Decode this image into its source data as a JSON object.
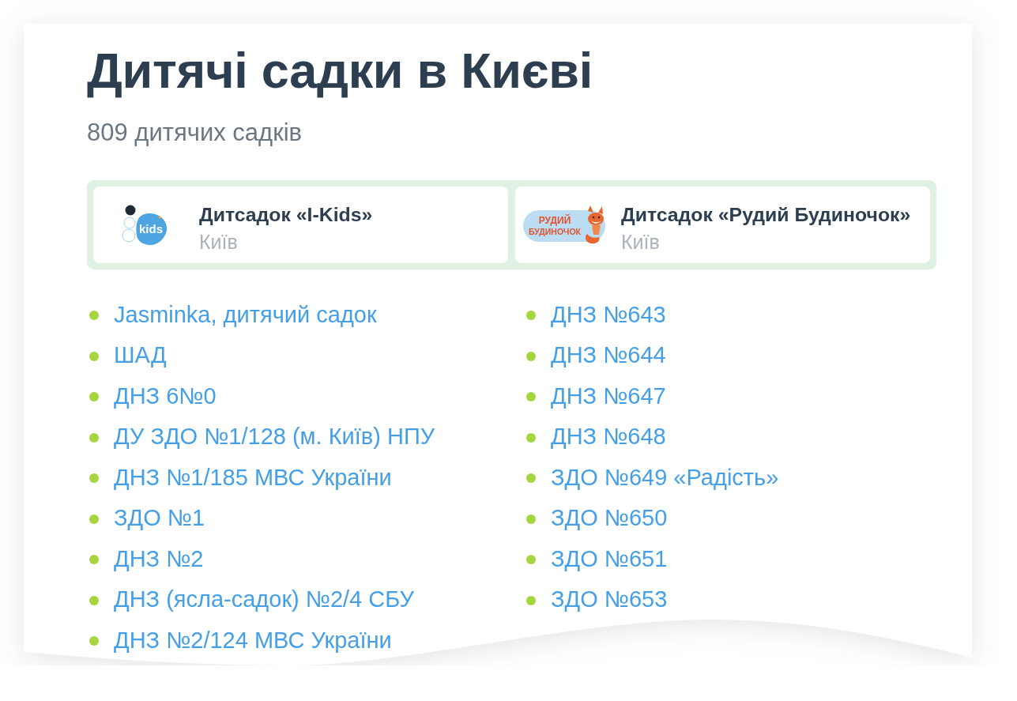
{
  "page": {
    "title": "Дитячі садки в Києві",
    "subtitle": "809 дитячих садків"
  },
  "featured": [
    {
      "kind": "ikids",
      "logo_text": [
        "kids"
      ],
      "name": "Дитсадок «I-Kids»",
      "city": "Київ"
    },
    {
      "kind": "fox",
      "logo_text": [
        "РУДИЙ",
        "БУДИНОЧОК"
      ],
      "name": "Дитсадок «Рудий Будиночок»",
      "city": "Київ"
    }
  ],
  "kindergartens": {
    "columns": [
      {
        "items": [
          "Jasminka, дитячий садок",
          "ШАД",
          "ДНЗ 6№0",
          "ДУ ЗДО №1/128 (м. Київ) НПУ",
          "ДНЗ №1/185 МВС України",
          "ЗДО №1",
          "ДНЗ №2",
          "ДНЗ (ясла-садок) №2/4 СБУ",
          "ДНЗ №2/124 МВС України"
        ]
      },
      {
        "items": [
          "ДНЗ №643",
          "ДНЗ №644",
          "ДНЗ №647",
          "ДНЗ №648",
          "ЗДО №649 «Радість»",
          "ЗДО №650",
          "ЗДО №651",
          "ЗДО №653"
        ]
      }
    ]
  }
}
